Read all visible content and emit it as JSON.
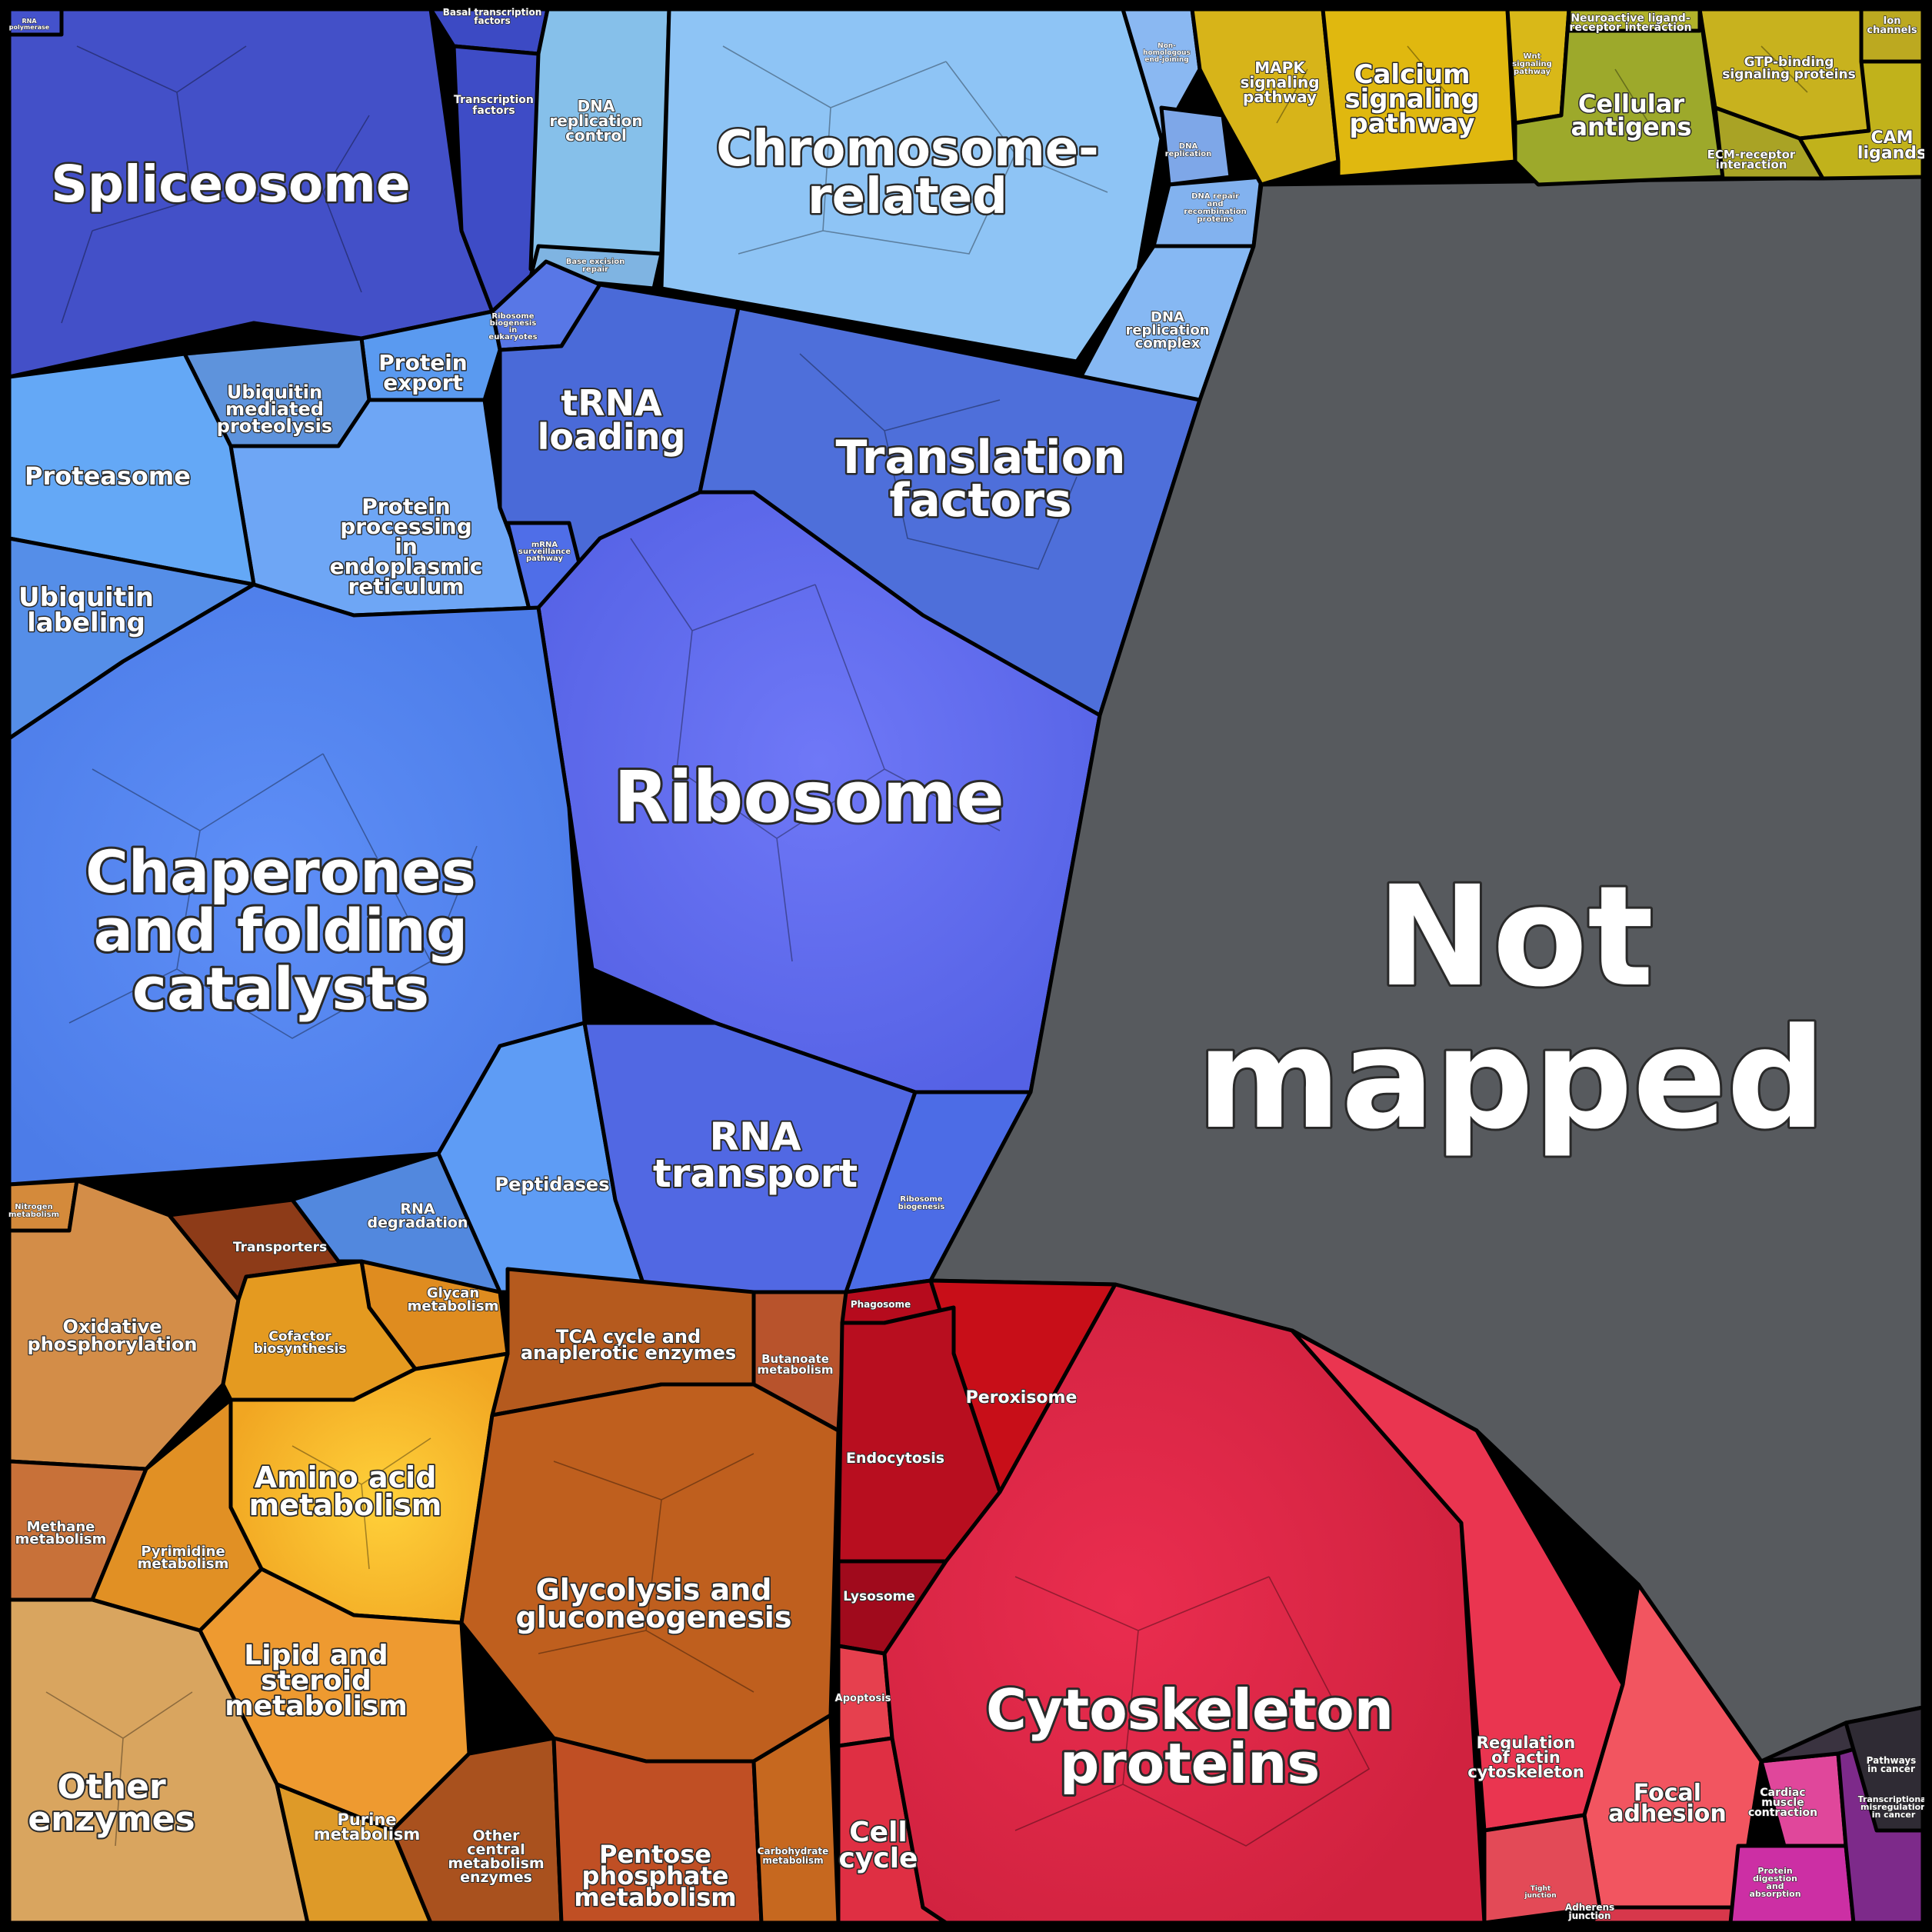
{
  "colors": {
    "background": "#000000",
    "not_mapped": "#575a5e",
    "genetic_information": "#5a82ee",
    "environmental": "#c9ad1f",
    "metabolism": "#d27f2a",
    "cellular_processes": "#d8254a",
    "organismal": "#b93aa3"
  },
  "labels": {
    "not_mapped_1": "Not",
    "not_mapped_2": "mapped",
    "spliceosome": "Spliceosome",
    "chromosome_1": "Chromosome-",
    "chromosome_2": "related",
    "ribosome": "Ribosome",
    "chaperones_1": "Chaperones",
    "chaperones_2": "and folding",
    "chaperones_3": "catalysts",
    "translation_factors_1": "Translation",
    "translation_factors_2": "factors",
    "trna_loading_1": "tRNA",
    "trna_loading_2": "loading",
    "rna_transport_1": "RNA",
    "rna_transport_2": "transport",
    "proteasome": "Proteasome",
    "ubiquitin_labeling_1": "Ubiquitin",
    "ubiquitin_labeling_2": "labeling",
    "ubiquitin_proteolysis_1": "Ubiquitin",
    "ubiquitin_proteolysis_2": "mediated",
    "ubiquitin_proteolysis_3": "proteolysis",
    "protein_export_1": "Protein",
    "protein_export_2": "export",
    "protein_processing_1": "Protein",
    "protein_processing_2": "processing",
    "protein_processing_3": "in",
    "protein_processing_4": "endoplasmic",
    "protein_processing_5": "reticulum",
    "dna_replication_control_1": "DNA",
    "dna_replication_control_2": "replication",
    "dna_replication_control_3": "control",
    "dna_replication_complex_1": "DNA",
    "dna_replication_complex_2": "replication",
    "dna_replication_complex_3": "complex",
    "transcription_factors_1": "Transcription",
    "transcription_factors_2": "factors",
    "basal_tf_1": "Basal transcription",
    "basal_tf_2": "factors",
    "peptidases": "Peptidases",
    "rna_degradation_1": "RNA",
    "rna_degradation_2": "degradation",
    "ribosome_biogenesis_1": "Ribosome",
    "ribosome_biogenesis_2": "biogenesis",
    "ribosome_biogenesis_euk_1": "Ribosome",
    "ribosome_biogenesis_euk_2": "biogenesis",
    "ribosome_biogenesis_euk_3": "in",
    "ribosome_biogenesis_euk_4": "eukaryotes",
    "mrna_surveillance_1": "mRNA",
    "mrna_surveillance_2": "surveillance",
    "mrna_surveillance_3": "pathway",
    "base_excision_1": "Base excision",
    "base_excision_2": "repair",
    "dna_repair_1": "DNA repair",
    "dna_repair_2": "and",
    "dna_repair_3": "recombination",
    "dna_repair_4": "proteins",
    "nhej_1": "Non-",
    "nhej_2": "homologous",
    "nhej_3": "end-joining",
    "dna_replication_small_1": "DNA",
    "dna_replication_small_2": "replication",
    "rna_polymerase_1": "RNA",
    "rna_polymerase_2": "polymerase",
    "mapk_1": "MAPK",
    "mapk_2": "signaling",
    "mapk_3": "pathway",
    "calcium_1": "Calcium",
    "calcium_2": "signaling",
    "calcium_3": "pathway",
    "cellular_antigens_1": "Cellular",
    "cellular_antigens_2": "antigens",
    "neuroactive_1": "Neuroactive ligand-",
    "neuroactive_2": "receptor interaction",
    "gtp_binding_1": "GTP-binding",
    "gtp_binding_2": "signaling proteins",
    "ecm_1": "ECM-receptor",
    "ecm_2": "interaction",
    "cam_ligands_1": "CAM",
    "cam_ligands_2": "ligands",
    "ion_channels_1": "Ion",
    "ion_channels_2": "channels",
    "wnt_1": "Wnt",
    "wnt_2": "signaling",
    "wnt_3": "pathway",
    "oxidative_1": "Oxidative",
    "oxidative_2": "phosphorylation",
    "nitrogen_1": "Nitrogen",
    "nitrogen_2": "metabolism",
    "transporters": "Transporters",
    "glycan_1": "Glycan",
    "glycan_2": "metabolism",
    "cofactor_1": "Cofactor",
    "cofactor_2": "biosynthesis",
    "tca_1": "TCA cycle and",
    "tca_2": "anaplerotic enzymes",
    "butanoate_1": "Butanoate",
    "butanoate_2": "metabolism",
    "amino_acid_1": "Amino acid",
    "amino_acid_2": "metabolism",
    "methane_1": "Methane",
    "methane_2": "metabolism",
    "pyrimidine_1": "Pyrimidine",
    "pyrimidine_2": "metabolism",
    "glycolysis_1": "Glycolysis and",
    "glycolysis_2": "gluconeogenesis",
    "lipid_1": "Lipid and",
    "lipid_2": "steroid",
    "lipid_3": "metabolism",
    "other_enzymes_1": "Other",
    "other_enzymes_2": "enzymes",
    "purine_1": "Purine",
    "purine_2": "metabolism",
    "other_central_1": "Other",
    "other_central_2": "central",
    "other_central_3": "metabolism",
    "other_central_4": "enzymes",
    "pentose_1": "Pentose",
    "pentose_2": "phosphate",
    "pentose_3": "metabolism",
    "carbohydrate_1": "Carbohydrate",
    "carbohydrate_2": "metabolism",
    "phagosome": "Phagosome",
    "peroxisome": "Peroxisome",
    "endocytosis": "Endocytosis",
    "lysosome": "Lysosome",
    "apoptosis": "Apoptosis",
    "cell_cycle_1": "Cell",
    "cell_cycle_2": "cycle",
    "cytoskeleton_1": "Cytoskeleton",
    "cytoskeleton_2": "proteins",
    "actin_1": "Regulation",
    "actin_2": "of actin",
    "actin_3": "cytoskeleton",
    "focal_1": "Focal",
    "focal_2": "adhesion",
    "tight_1": "Tight",
    "tight_2": "junction",
    "adherens_1": "Adherens",
    "adherens_2": "junction",
    "cardiac_1": "Cardiac",
    "cardiac_2": "muscle",
    "cardiac_3": "contraction",
    "protein_digestion_1": "Protein",
    "protein_digestion_2": "digestion",
    "protein_digestion_3": "and",
    "protein_digestion_4": "absorption",
    "pathways_cancer_1": "Pathways",
    "pathways_cancer_2": "in cancer",
    "transcriptional_1": "Transcriptional",
    "transcriptional_2": "misregulation",
    "transcriptional_3": "in cancer"
  }
}
